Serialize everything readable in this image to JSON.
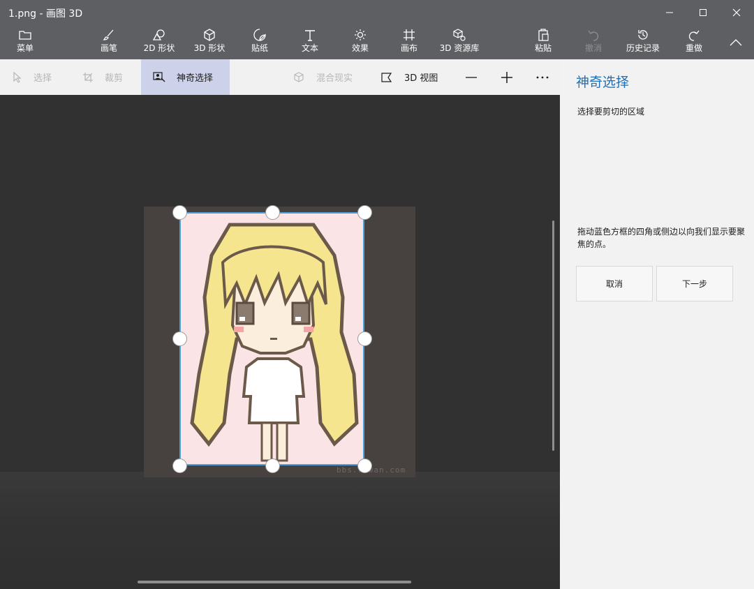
{
  "window": {
    "title": "1.png - 画图 3D"
  },
  "ribbon": {
    "menu": "菜单",
    "brush": "画笔",
    "shapes2d": "2D 形状",
    "shapes3d": "3D 形状",
    "stickers": "贴纸",
    "text": "文本",
    "effects": "效果",
    "canvas": "画布",
    "library3d": "3D 资源库",
    "paste": "粘贴",
    "undo": "撤消",
    "history": "历史记录",
    "redo": "重做"
  },
  "subbar": {
    "select": "选择",
    "crop": "裁剪",
    "magic_select": "神奇选择",
    "mixed_reality": "混合现实",
    "view3d": "3D 视图"
  },
  "canvas": {
    "watermark": "bbs.ruwan.com"
  },
  "panel": {
    "title": "神奇选择",
    "subtitle": "选择要剪切的区域",
    "help": "拖动蓝色方框的四角或侧边以向我们显示要聚焦的点。",
    "cancel": "取消",
    "next": "下一步"
  },
  "colors": {
    "accent": "#1e6fb8",
    "selection": "#4aa1dc",
    "toolbar": "#5d5f63"
  }
}
